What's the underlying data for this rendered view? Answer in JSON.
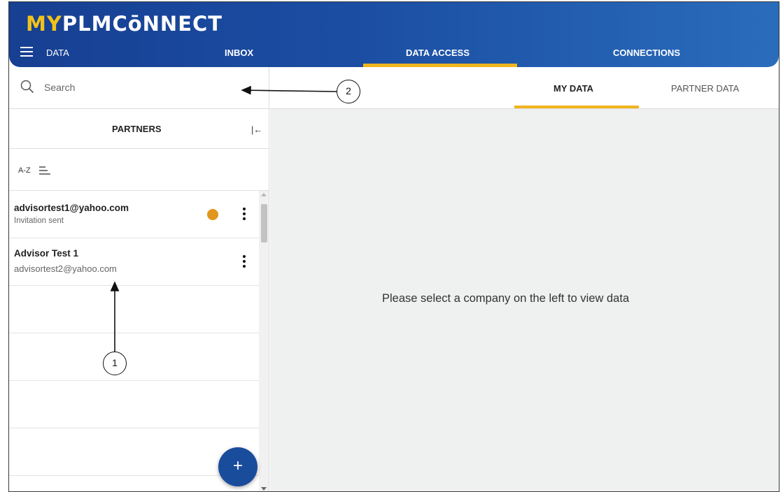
{
  "app": {
    "logo_prefix": "MY",
    "logo_rest": "PLMCōNNECT"
  },
  "nav": {
    "section_label": "DATA",
    "tabs": [
      {
        "label": "INBOX",
        "active": false
      },
      {
        "label": "DATA ACCESS",
        "active": true
      },
      {
        "label": "CONNECTIONS",
        "active": false
      }
    ]
  },
  "search": {
    "placeholder": "Search",
    "value": ""
  },
  "subtabs": [
    {
      "label": "MY DATA",
      "active": true
    },
    {
      "label": "PARTNER DATA",
      "active": false
    }
  ],
  "partners": {
    "title": "PARTNERS",
    "collapse_icon": "collapse-left-icon",
    "sort_label": "A-Z",
    "items": [
      {
        "title": "advisortest1@yahoo.com",
        "subtitle": "Invitation sent",
        "status": "pending"
      },
      {
        "title": "Advisor Test 1",
        "subtitle": "advisortest2@yahoo.com",
        "status": ""
      }
    ],
    "add_button_label": "+"
  },
  "main": {
    "empty_message": "Please select a company on the left to view data"
  },
  "annotations": [
    {
      "label": "1"
    },
    {
      "label": "2"
    }
  ],
  "colors": {
    "header": "#1b4ea3",
    "accent": "#f0b51d",
    "status_pending": "#e0951c",
    "fab": "#1a4c9c"
  }
}
